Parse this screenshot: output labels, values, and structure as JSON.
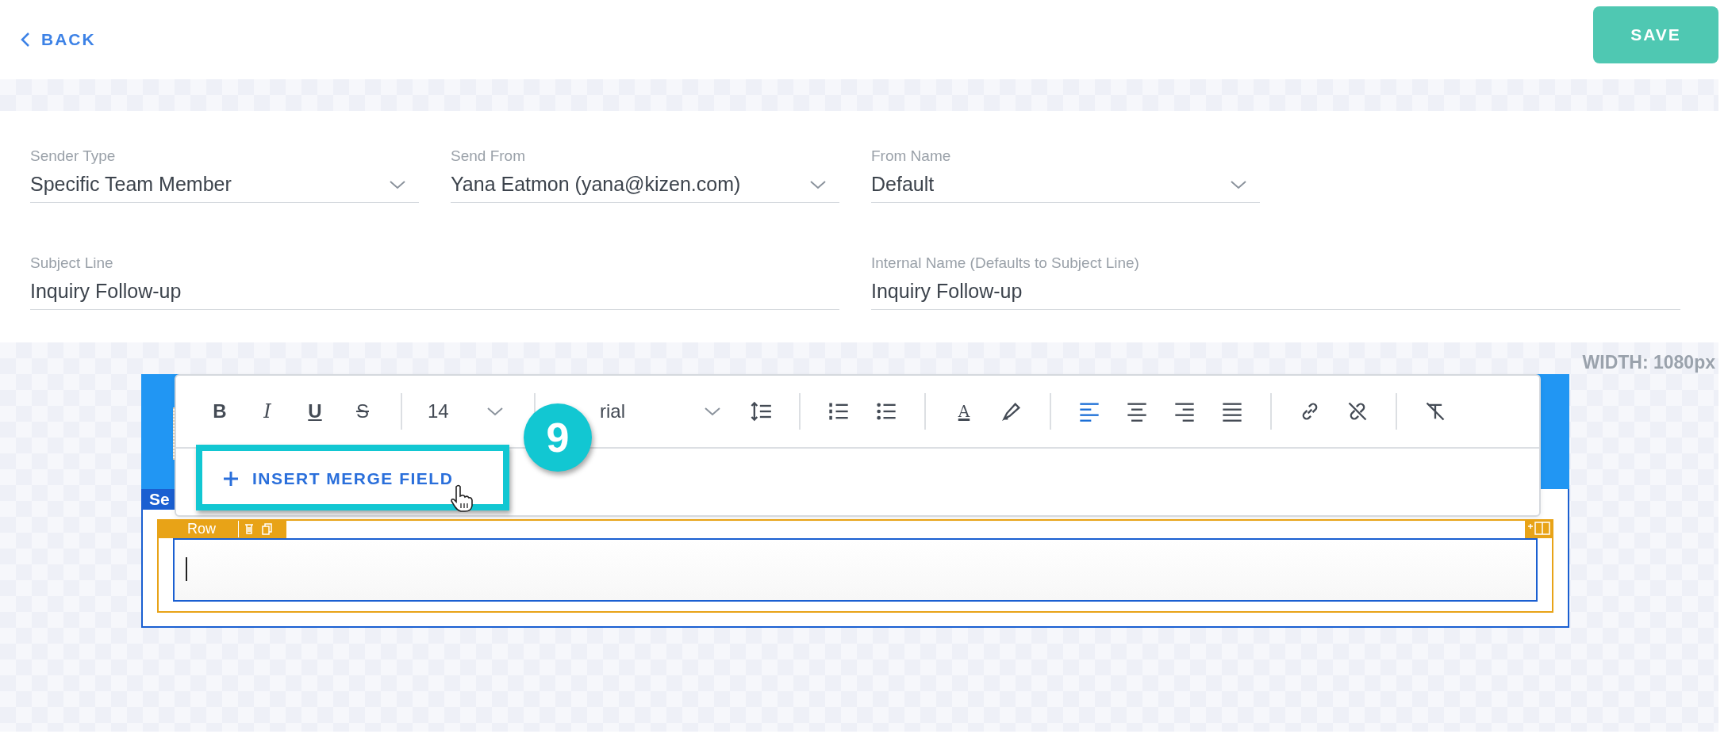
{
  "top_bar": {
    "back_label": "BACK",
    "save_label": "SAVE"
  },
  "form": {
    "sender_type": {
      "label": "Sender Type",
      "value": "Specific Team Member",
      "kind": "dropdown"
    },
    "send_from": {
      "label": "Send From",
      "value": "Yana Eatmon (yana@kizen.com)",
      "kind": "dropdown"
    },
    "from_name": {
      "label": "From Name",
      "value": "Default",
      "kind": "dropdown"
    },
    "subject_line": {
      "label": "Subject Line",
      "value": "Inquiry Follow-up",
      "kind": "text"
    },
    "internal_name": {
      "label": "Internal Name (Defaults to Subject Line)",
      "value": "Inquiry Follow-up",
      "kind": "text"
    }
  },
  "canvas": {
    "width_label": "WIDTH: 1080px",
    "section_tab": "Se",
    "row_label": "Row"
  },
  "editor_toolbar": {
    "groups": [
      [
        {
          "kind": "bold",
          "label": "B"
        },
        {
          "kind": "italic",
          "label": "I"
        },
        {
          "kind": "underline",
          "label": "U"
        },
        {
          "kind": "strike",
          "label": "S"
        }
      ],
      [
        {
          "kind": "size",
          "label": "14"
        }
      ],
      [
        {
          "kind": "font",
          "label": "rial"
        },
        {
          "kind": "line-height"
        }
      ],
      [
        {
          "kind": "numbered"
        },
        {
          "kind": "bullets"
        }
      ],
      [
        {
          "kind": "text-color",
          "label": "A"
        },
        {
          "kind": "highlight"
        }
      ],
      [
        {
          "kind": "align-left",
          "selected": true
        },
        {
          "kind": "align-center",
          "selected": false
        },
        {
          "kind": "align-right",
          "selected": false
        },
        {
          "kind": "justify",
          "selected": false
        }
      ],
      [
        {
          "kind": "link"
        },
        {
          "kind": "unlink"
        }
      ],
      [
        {
          "kind": "clear-format"
        }
      ]
    ]
  },
  "merge_button": {
    "label": "INSERT MERGE FIELD"
  },
  "step_badge": "9"
}
